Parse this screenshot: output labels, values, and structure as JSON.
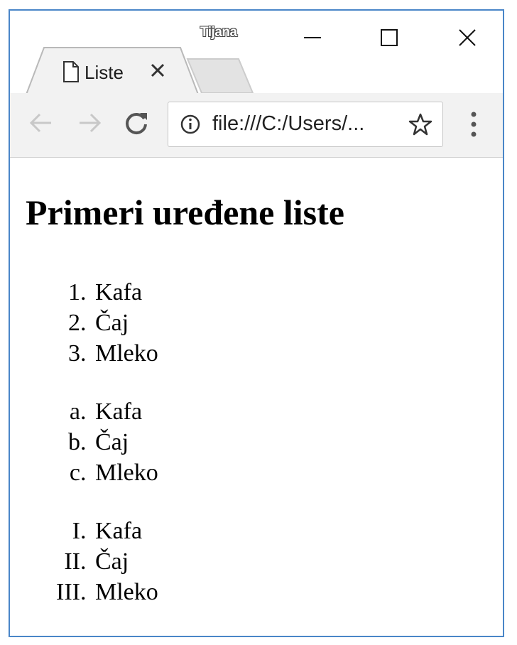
{
  "browser": {
    "profile_name": "Tijana",
    "tab": {
      "title": "Liste"
    },
    "address_bar": {
      "url_display": "file:///C:/Users/..."
    }
  },
  "page": {
    "heading": "Primeri uređene liste",
    "ordered_list_numeric": [
      "Kafa",
      "Čaj",
      "Mleko"
    ],
    "ordered_list_lower_alpha": [
      "Kafa",
      "Čaj",
      "Mleko"
    ],
    "ordered_list_upper_roman": [
      "Kafa",
      "Čaj",
      "Mleko"
    ]
  },
  "icons": {
    "tab": [
      "page-icon",
      "close-icon"
    ],
    "window_controls": [
      "minimize-icon",
      "maximize-icon",
      "close-icon"
    ],
    "toolbar": [
      "back-arrow-icon",
      "forward-arrow-icon",
      "reload-icon",
      "info-icon",
      "star-icon",
      "menu-dots-icon"
    ]
  },
  "colors": {
    "window_border": "#4a86c8",
    "toolbar_bg": "#f2f2f2",
    "disabled_arrow": "#c8c8c8"
  }
}
